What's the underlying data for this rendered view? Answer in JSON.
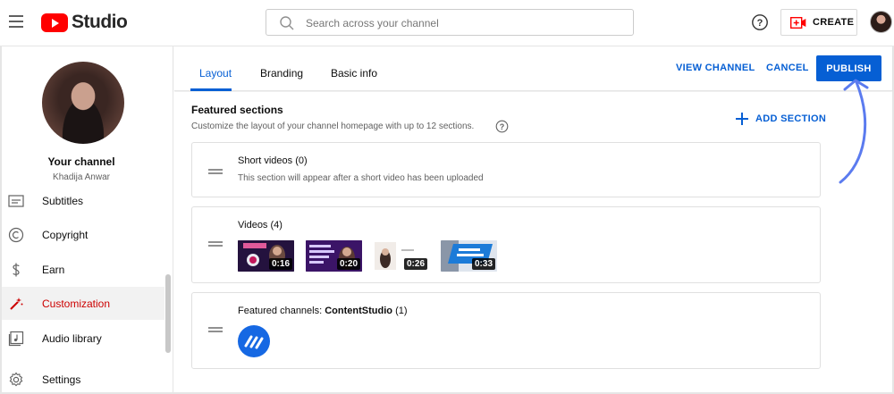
{
  "topbar": {
    "logo_text": "Studio",
    "search_placeholder": "Search across your channel",
    "create_label": "CREATE"
  },
  "sidebar": {
    "channel_title": "Your channel",
    "channel_name": "Khadija Anwar",
    "items": [
      {
        "label": "Subtitles",
        "icon": "subtitles-icon"
      },
      {
        "label": "Copyright",
        "icon": "copyright-icon"
      },
      {
        "label": "Earn",
        "icon": "dollar-icon"
      },
      {
        "label": "Customization",
        "icon": "magic-wand-icon",
        "active": true
      },
      {
        "label": "Audio library",
        "icon": "audio-library-icon"
      },
      {
        "label": "Settings",
        "icon": "gear-icon"
      }
    ]
  },
  "header": {
    "tabs": [
      {
        "label": "Layout",
        "active": true
      },
      {
        "label": "Branding"
      },
      {
        "label": "Basic info"
      }
    ],
    "view_channel": "VIEW CHANNEL",
    "cancel": "CANCEL",
    "publish": "PUBLISH"
  },
  "featured": {
    "title": "Featured sections",
    "description": "Customize the layout of your channel homepage with up to 12 sections.",
    "add_section": "ADD SECTION",
    "cards": [
      {
        "title": "Short videos",
        "count": "(0)",
        "subtitle": "This section will appear after a short video has been uploaded"
      },
      {
        "title": "Videos",
        "count": "(4)",
        "videos": [
          {
            "duration": "0:16"
          },
          {
            "duration": "0:20",
            "thumb_text": "ARTICULATE YOUR THOUGHTS WITH WORDS"
          },
          {
            "duration": "0:26"
          },
          {
            "duration": "0:33",
            "thumb_text": "DIGITAL COPYWRITING"
          }
        ]
      },
      {
        "title_prefix": "Featured channels:",
        "title_bold": "ContentStudio",
        "count": "(1)"
      }
    ]
  },
  "colors": {
    "accent": "#065fd4",
    "brand_red": "#ff0000",
    "active_red": "#cc0000",
    "annotation_arrow": "#5b7bef"
  }
}
